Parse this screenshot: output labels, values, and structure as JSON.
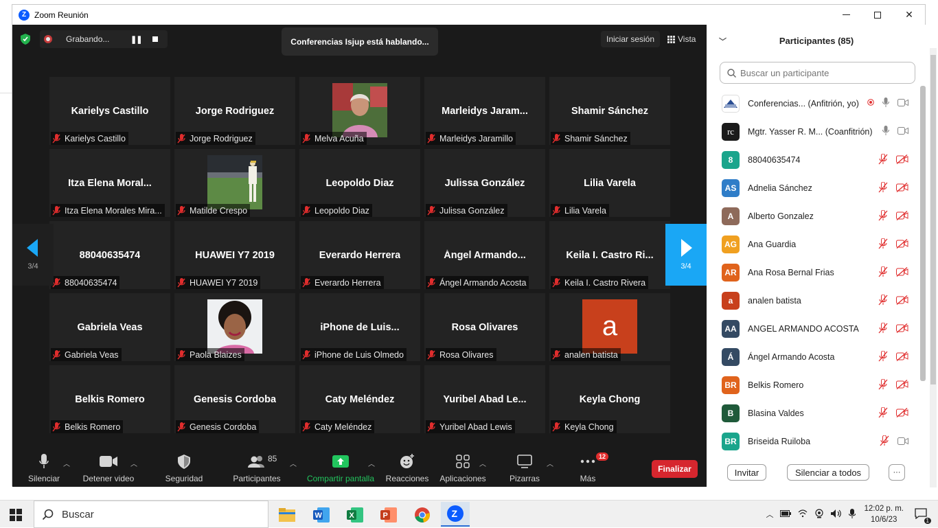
{
  "window": {
    "title": "Zoom Reunión",
    "minimize": "—",
    "maximize": "☐",
    "close": "✕"
  },
  "recording": {
    "label": "Grabando..."
  },
  "speaking": "Conferencias Isjup está hablando...",
  "top_right": {
    "signin": "Iniciar sesión",
    "view": "Vista"
  },
  "nav": {
    "page_left": "3/4",
    "page_right": "3/4"
  },
  "tiles": [
    {
      "big": "Karielys Castillo",
      "label": "Karielys Castillo",
      "photo": ""
    },
    {
      "big": "Jorge Rodriguez",
      "label": "Jorge Rodriguez",
      "photo": ""
    },
    {
      "big": "",
      "label": "Melva Acuña",
      "photo": "woman-portrait"
    },
    {
      "big": "Marleidys  Jaram...",
      "label": "Marleidys Jaramillo",
      "photo": ""
    },
    {
      "big": "Shamir Sánchez",
      "label": "Shamir Sánchez",
      "photo": ""
    },
    {
      "big": "Itza  Elena  Moral...",
      "label": "Itza Elena Morales Mira...",
      "photo": ""
    },
    {
      "big": "",
      "label": "Matilde Crespo",
      "photo": "baseball-player"
    },
    {
      "big": "Leopoldo Diaz",
      "label": "Leopoldo Diaz",
      "photo": ""
    },
    {
      "big": "Julissa González",
      "label": "Julissa González",
      "photo": ""
    },
    {
      "big": "Lilia Varela",
      "label": "Lilia Varela",
      "photo": ""
    },
    {
      "big": "88040635474",
      "label": "88040635474",
      "photo": ""
    },
    {
      "big": "HUAWEI Y7 2019",
      "label": "HUAWEI Y7 2019",
      "photo": ""
    },
    {
      "big": "Everardo Herrera",
      "label": "Everardo Herrera",
      "photo": ""
    },
    {
      "big": "Ángel  Armando...",
      "label": "Ángel Armando Acosta",
      "photo": ""
    },
    {
      "big": "Keila  I.  Castro  Ri...",
      "label": "Keila I. Castro Rivera",
      "photo": ""
    },
    {
      "big": "Gabriela Veas",
      "label": "Gabriela Veas",
      "photo": ""
    },
    {
      "big": "",
      "label": "Paola Blaizes",
      "photo": "woman-smiling"
    },
    {
      "big": "iPhone  de  Luis...",
      "label": "iPhone de Luis Olmedo",
      "photo": ""
    },
    {
      "big": "Rosa Olivares",
      "label": "Rosa Olivares",
      "photo": ""
    },
    {
      "big": "",
      "label": "analen batista",
      "photo": "avatar-a"
    },
    {
      "big": "Belkis Romero",
      "label": "Belkis Romero",
      "photo": ""
    },
    {
      "big": "Genesis Cordoba",
      "label": "Genesis Cordoba",
      "photo": ""
    },
    {
      "big": "Caty Meléndez",
      "label": "Caty Meléndez",
      "photo": ""
    },
    {
      "big": "Yuribel  Abad  Le...",
      "label": "Yuribel Abad Lewis",
      "photo": ""
    },
    {
      "big": "Keyla Chong",
      "label": "Keyla Chong",
      "photo": ""
    }
  ],
  "avatar_a_letter": "a",
  "toolbar": {
    "mute": "Silenciar",
    "video": "Detener video",
    "security": "Seguridad",
    "participants": "Participantes",
    "participants_count": "85",
    "share": "Compartir pantalla",
    "reactions": "Reacciones",
    "apps": "Aplicaciones",
    "whiteboards": "Pizarras",
    "more": "Más",
    "more_badge": "12",
    "end": "Finalizar"
  },
  "panel": {
    "title": "Participantes (85)",
    "search_placeholder": "Buscar un participante",
    "invite": "Invitar",
    "mute_all": "Silenciar a todos",
    "more": "···",
    "participants": [
      {
        "initials": "",
        "name": "Conferencias... (Anfitrión, yo)",
        "color": "#ffffff",
        "logo": "isjup",
        "mic": "on",
        "video": "on",
        "rec": true
      },
      {
        "initials": "",
        "name": "Mgtr. Yasser R. M... (Coanfitrión)",
        "color": "#1b1b1b",
        "logo": "yc",
        "mic": "on",
        "video": "on",
        "rec": false
      },
      {
        "initials": "8",
        "name": "88040635474",
        "color": "#1aa58c",
        "mic": "off",
        "video": "off"
      },
      {
        "initials": "AS",
        "name": "Adnelia Sánchez",
        "color": "#2f7dc8",
        "mic": "off",
        "video": "off"
      },
      {
        "initials": "A",
        "name": "Alberto Gonzalez",
        "color": "#8e6a5a",
        "mic": "off",
        "video": "off"
      },
      {
        "initials": "AG",
        "name": "Ana Guardia",
        "color": "#f0a020",
        "mic": "off",
        "video": "off"
      },
      {
        "initials": "AR",
        "name": "Ana Rosa Bernal Frias",
        "color": "#e0631c",
        "mic": "off",
        "video": "off"
      },
      {
        "initials": "a",
        "name": "analen batista",
        "color": "#c8401c",
        "mic": "off",
        "video": "off"
      },
      {
        "initials": "AA",
        "name": "ANGEL ARMANDO ACOSTA",
        "color": "#344a63",
        "mic": "off",
        "video": "off"
      },
      {
        "initials": "Á",
        "name": "Ángel Armando Acosta",
        "color": "#344a63",
        "mic": "off",
        "video": "off"
      },
      {
        "initials": "BR",
        "name": "Belkis Romero",
        "color": "#e0631c",
        "mic": "off",
        "video": "off"
      },
      {
        "initials": "B",
        "name": "Blasina Valdes",
        "color": "#1f5a3a",
        "mic": "off",
        "video": "off"
      },
      {
        "initials": "BR",
        "name": "Briseida Ruiloba",
        "color": "#1aa58c",
        "mic": "off",
        "video": "on"
      }
    ]
  },
  "taskbar": {
    "search": "Buscar",
    "time": "12:02 p. m.",
    "date": "10/6/23",
    "notif": "1"
  },
  "colors": {
    "accent": "#1aa7f5",
    "end": "#d6262e",
    "share": "#22c55e",
    "muted": "#e02d2d"
  }
}
